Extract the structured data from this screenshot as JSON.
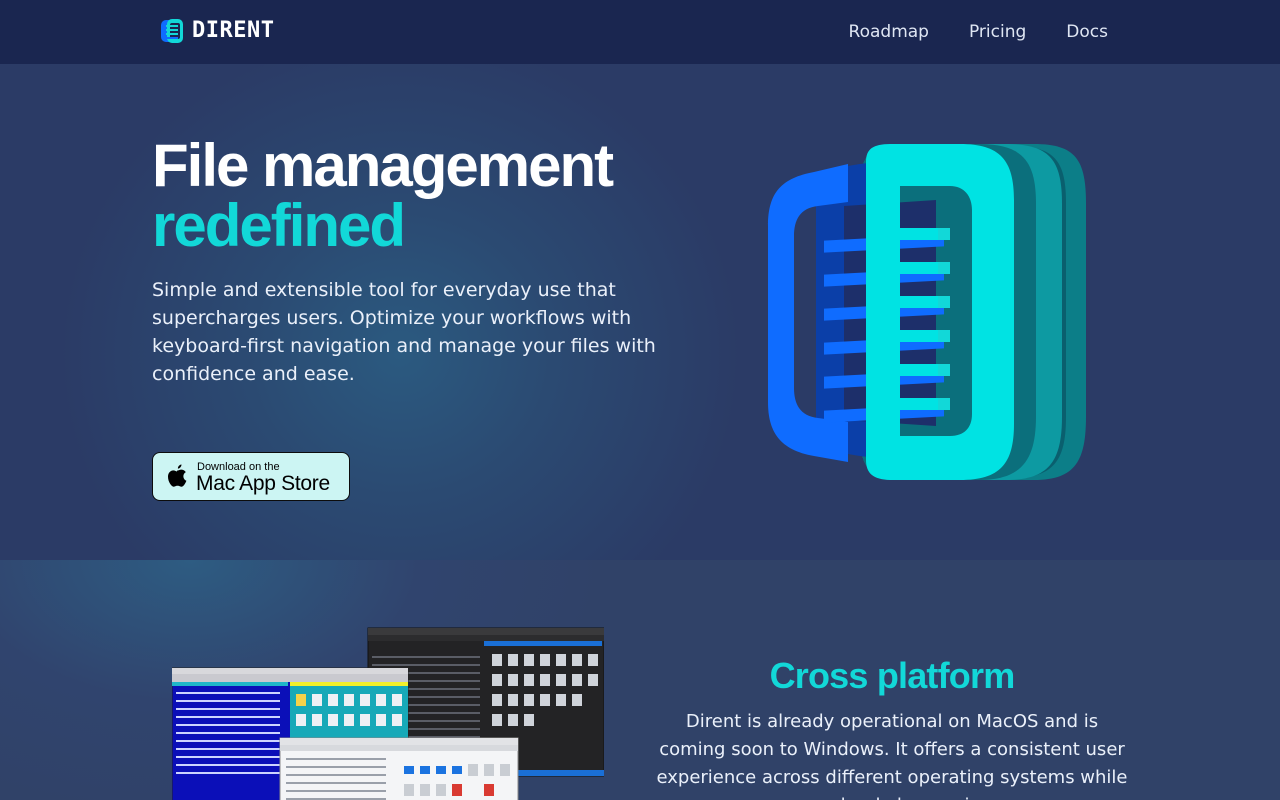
{
  "nav": {
    "logo_text": "DIRENT",
    "links": [
      "Roadmap",
      "Pricing",
      "Docs"
    ]
  },
  "hero": {
    "title_line1": "File management",
    "title_line2": "redefined",
    "subtitle": "Simple and extensible tool for everyday use that supercharges users. Optimize your workflows with keyboard-first navigation and manage your files with confidence and ease.",
    "appstore_small": "Download on the",
    "appstore_big": "Mac App Store"
  },
  "feature": {
    "title": "Cross platform",
    "text": "Dirent is already operational on MacOS and is coming soon to Windows. It offers a consistent user experience across different operating systems while seamlessly leveraging"
  },
  "icons": [
    "dirent-logo-icon",
    "apple-icon",
    "dirent-logo-art"
  ],
  "colors": {
    "nav_bg": "#1a2650",
    "page_bg": "#2f3f68",
    "accent_cyan": "#12d8d8",
    "accent_blue": "#0f6cff",
    "appstore_bg": "#ccf5f3"
  }
}
